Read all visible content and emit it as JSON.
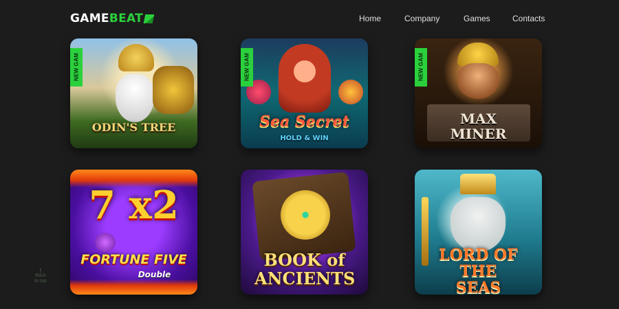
{
  "logo": {
    "game": "GAME",
    "beat": "BEAT"
  },
  "nav": [
    {
      "label": "Home"
    },
    {
      "label": "Company"
    },
    {
      "label": "Games"
    },
    {
      "label": "Contacts"
    }
  ],
  "badge_text": "NEW GAM",
  "games": [
    {
      "title": "ODIN'S TREE",
      "subtitle": "",
      "is_new": true
    },
    {
      "title": "Sea Secret",
      "subtitle": "HOLD & WIN",
      "is_new": true
    },
    {
      "title": "MAX MINER",
      "subtitle": "",
      "is_new": true
    },
    {
      "title": "FORTUNE FIVE",
      "subtitle": "Double",
      "extra": "7 x2",
      "is_new": false
    },
    {
      "title": "BOOK of ANCIENTS",
      "subtitle": "",
      "is_new": false
    },
    {
      "title": "LORD OF THE SEAS",
      "subtitle": "",
      "is_new": false
    }
  ],
  "back_to_top": {
    "line1": "Back",
    "line2": "to top"
  },
  "colors": {
    "background": "#1c1c1c",
    "accent": "#2bd13c",
    "nav_text": "#e0e0e0"
  }
}
